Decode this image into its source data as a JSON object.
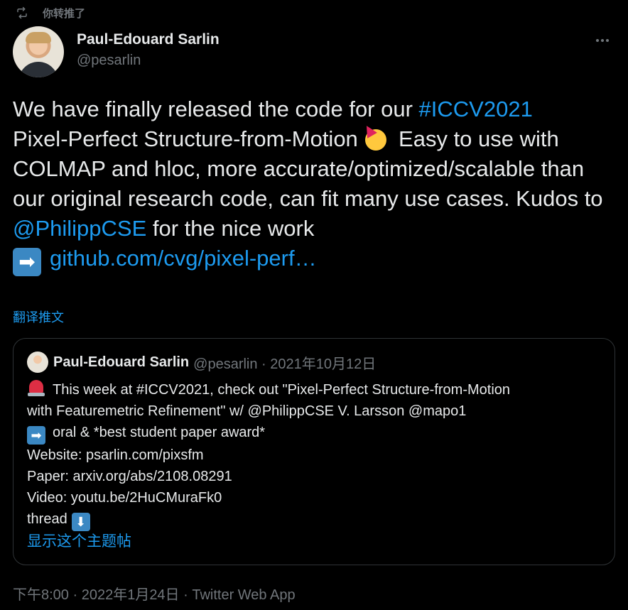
{
  "retweet": {
    "label": "你转推了"
  },
  "author": {
    "name": "Paul-Edouard Sarlin",
    "handle": "@pesarlin"
  },
  "tweet": {
    "text_1": "We have finally released the code for our ",
    "hashtag": "#ICCV2021",
    "text_2": "Pixel-Perfect Structure-from-Motion ",
    "text_3": " Easy to use with COLMAP and hloc, more accurate/optimized/scalable than our original research code, can fit many use cases. Kudos to ",
    "mention": "@PhilippCSE",
    "text_4": " for the nice work",
    "link": "github.com/cvg/pixel-perf…",
    "translate": "翻译推文"
  },
  "quote": {
    "name": "Paul-Edouard Sarlin",
    "meta": "@pesarlin · 2021年10月12日",
    "line_1": "This week at #ICCV2021, check out \"Pixel-Perfect Structure-from-Motion",
    "line_2": "with Featuremetric Refinement\" w/ @PhilippCSE V. Larsson @mapo1",
    "line_3": "oral & *best student paper award*",
    "line_4": "Website: psarlin.com/pixsfm",
    "line_5": "Paper: arxiv.org/abs/2108.08291",
    "line_6": "Video: youtu.be/2HuCMuraFk0",
    "line_7": "thread",
    "show_thread": "显示这个主题帖"
  },
  "footer": {
    "meta": "下午8:00 · 2022年1月24日 · Twitter Web App"
  },
  "icons": {
    "retweet": "retweet-icon",
    "more": "more-icon",
    "party": "party-face-emoji-icon",
    "arrow_right": "right-arrow-emoji-icon",
    "siren": "siren-emoji-icon",
    "arrow_down": "down-arrow-emoji-icon"
  },
  "colors": {
    "accent": "#1d9bf0",
    "secondary_text": "#71767b",
    "primary_text": "#e7e9ea",
    "background": "#000000",
    "border": "#2f3336"
  }
}
